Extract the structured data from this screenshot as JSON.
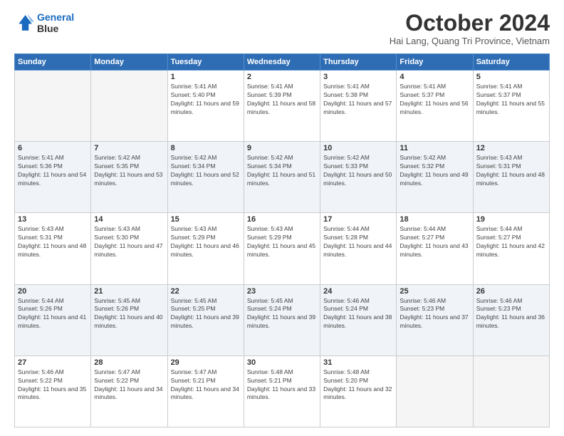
{
  "logo": {
    "line1": "General",
    "line2": "Blue"
  },
  "header": {
    "month": "October 2024",
    "location": "Hai Lang, Quang Tri Province, Vietnam"
  },
  "days_of_week": [
    "Sunday",
    "Monday",
    "Tuesday",
    "Wednesday",
    "Thursday",
    "Friday",
    "Saturday"
  ],
  "weeks": [
    [
      {
        "day": "",
        "sunrise": "",
        "sunset": "",
        "daylight": "",
        "empty": true
      },
      {
        "day": "",
        "sunrise": "",
        "sunset": "",
        "daylight": "",
        "empty": true
      },
      {
        "day": "1",
        "sunrise": "Sunrise: 5:41 AM",
        "sunset": "Sunset: 5:40 PM",
        "daylight": "Daylight: 11 hours and 59 minutes."
      },
      {
        "day": "2",
        "sunrise": "Sunrise: 5:41 AM",
        "sunset": "Sunset: 5:39 PM",
        "daylight": "Daylight: 11 hours and 58 minutes."
      },
      {
        "day": "3",
        "sunrise": "Sunrise: 5:41 AM",
        "sunset": "Sunset: 5:38 PM",
        "daylight": "Daylight: 11 hours and 57 minutes."
      },
      {
        "day": "4",
        "sunrise": "Sunrise: 5:41 AM",
        "sunset": "Sunset: 5:37 PM",
        "daylight": "Daylight: 11 hours and 56 minutes."
      },
      {
        "day": "5",
        "sunrise": "Sunrise: 5:41 AM",
        "sunset": "Sunset: 5:37 PM",
        "daylight": "Daylight: 11 hours and 55 minutes."
      }
    ],
    [
      {
        "day": "6",
        "sunrise": "Sunrise: 5:41 AM",
        "sunset": "Sunset: 5:36 PM",
        "daylight": "Daylight: 11 hours and 54 minutes."
      },
      {
        "day": "7",
        "sunrise": "Sunrise: 5:42 AM",
        "sunset": "Sunset: 5:35 PM",
        "daylight": "Daylight: 11 hours and 53 minutes."
      },
      {
        "day": "8",
        "sunrise": "Sunrise: 5:42 AM",
        "sunset": "Sunset: 5:34 PM",
        "daylight": "Daylight: 11 hours and 52 minutes."
      },
      {
        "day": "9",
        "sunrise": "Sunrise: 5:42 AM",
        "sunset": "Sunset: 5:34 PM",
        "daylight": "Daylight: 11 hours and 51 minutes."
      },
      {
        "day": "10",
        "sunrise": "Sunrise: 5:42 AM",
        "sunset": "Sunset: 5:33 PM",
        "daylight": "Daylight: 11 hours and 50 minutes."
      },
      {
        "day": "11",
        "sunrise": "Sunrise: 5:42 AM",
        "sunset": "Sunset: 5:32 PM",
        "daylight": "Daylight: 11 hours and 49 minutes."
      },
      {
        "day": "12",
        "sunrise": "Sunrise: 5:43 AM",
        "sunset": "Sunset: 5:31 PM",
        "daylight": "Daylight: 11 hours and 48 minutes."
      }
    ],
    [
      {
        "day": "13",
        "sunrise": "Sunrise: 5:43 AM",
        "sunset": "Sunset: 5:31 PM",
        "daylight": "Daylight: 11 hours and 48 minutes."
      },
      {
        "day": "14",
        "sunrise": "Sunrise: 5:43 AM",
        "sunset": "Sunset: 5:30 PM",
        "daylight": "Daylight: 11 hours and 47 minutes."
      },
      {
        "day": "15",
        "sunrise": "Sunrise: 5:43 AM",
        "sunset": "Sunset: 5:29 PM",
        "daylight": "Daylight: 11 hours and 46 minutes."
      },
      {
        "day": "16",
        "sunrise": "Sunrise: 5:43 AM",
        "sunset": "Sunset: 5:29 PM",
        "daylight": "Daylight: 11 hours and 45 minutes."
      },
      {
        "day": "17",
        "sunrise": "Sunrise: 5:44 AM",
        "sunset": "Sunset: 5:28 PM",
        "daylight": "Daylight: 11 hours and 44 minutes."
      },
      {
        "day": "18",
        "sunrise": "Sunrise: 5:44 AM",
        "sunset": "Sunset: 5:27 PM",
        "daylight": "Daylight: 11 hours and 43 minutes."
      },
      {
        "day": "19",
        "sunrise": "Sunrise: 5:44 AM",
        "sunset": "Sunset: 5:27 PM",
        "daylight": "Daylight: 11 hours and 42 minutes."
      }
    ],
    [
      {
        "day": "20",
        "sunrise": "Sunrise: 5:44 AM",
        "sunset": "Sunset: 5:26 PM",
        "daylight": "Daylight: 11 hours and 41 minutes."
      },
      {
        "day": "21",
        "sunrise": "Sunrise: 5:45 AM",
        "sunset": "Sunset: 5:26 PM",
        "daylight": "Daylight: 11 hours and 40 minutes."
      },
      {
        "day": "22",
        "sunrise": "Sunrise: 5:45 AM",
        "sunset": "Sunset: 5:25 PM",
        "daylight": "Daylight: 11 hours and 39 minutes."
      },
      {
        "day": "23",
        "sunrise": "Sunrise: 5:45 AM",
        "sunset": "Sunset: 5:24 PM",
        "daylight": "Daylight: 11 hours and 39 minutes."
      },
      {
        "day": "24",
        "sunrise": "Sunrise: 5:46 AM",
        "sunset": "Sunset: 5:24 PM",
        "daylight": "Daylight: 11 hours and 38 minutes."
      },
      {
        "day": "25",
        "sunrise": "Sunrise: 5:46 AM",
        "sunset": "Sunset: 5:23 PM",
        "daylight": "Daylight: 11 hours and 37 minutes."
      },
      {
        "day": "26",
        "sunrise": "Sunrise: 5:46 AM",
        "sunset": "Sunset: 5:23 PM",
        "daylight": "Daylight: 11 hours and 36 minutes."
      }
    ],
    [
      {
        "day": "27",
        "sunrise": "Sunrise: 5:46 AM",
        "sunset": "Sunset: 5:22 PM",
        "daylight": "Daylight: 11 hours and 35 minutes."
      },
      {
        "day": "28",
        "sunrise": "Sunrise: 5:47 AM",
        "sunset": "Sunset: 5:22 PM",
        "daylight": "Daylight: 11 hours and 34 minutes."
      },
      {
        "day": "29",
        "sunrise": "Sunrise: 5:47 AM",
        "sunset": "Sunset: 5:21 PM",
        "daylight": "Daylight: 11 hours and 34 minutes."
      },
      {
        "day": "30",
        "sunrise": "Sunrise: 5:48 AM",
        "sunset": "Sunset: 5:21 PM",
        "daylight": "Daylight: 11 hours and 33 minutes."
      },
      {
        "day": "31",
        "sunrise": "Sunrise: 5:48 AM",
        "sunset": "Sunset: 5:20 PM",
        "daylight": "Daylight: 11 hours and 32 minutes."
      },
      {
        "day": "",
        "sunrise": "",
        "sunset": "",
        "daylight": "",
        "empty": true
      },
      {
        "day": "",
        "sunrise": "",
        "sunset": "",
        "daylight": "",
        "empty": true
      }
    ]
  ]
}
